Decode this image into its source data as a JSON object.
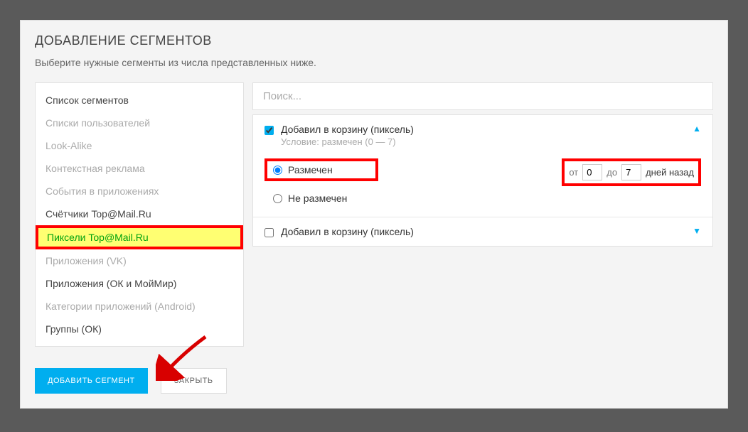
{
  "header": {
    "title": "ДОБАВЛЕНИЕ СЕГМЕНТОВ",
    "subtitle": "Выберите нужные сегменты из числа представленных ниже."
  },
  "segments": {
    "items": [
      {
        "label": "Список сегментов",
        "disabled": false
      },
      {
        "label": "Списки пользователей",
        "disabled": true
      },
      {
        "label": "Look-Alike",
        "disabled": true
      },
      {
        "label": "Контекстная реклама",
        "disabled": true
      },
      {
        "label": "События в приложениях",
        "disabled": true
      },
      {
        "label": "Счётчики Top@Mail.Ru",
        "disabled": false
      },
      {
        "label": "Пиксели Top@Mail.Ru",
        "disabled": false,
        "highlighted": true
      },
      {
        "label": "Приложения (VK)",
        "disabled": true
      },
      {
        "label": "Приложения (ОК и МойМир)",
        "disabled": false
      },
      {
        "label": "Категории приложений (Android)",
        "disabled": true
      },
      {
        "label": "Группы (ОК)",
        "disabled": false
      }
    ]
  },
  "search": {
    "placeholder": "Поиск..."
  },
  "accordion": {
    "item1": {
      "title": "Добавил в корзину (пиксель)",
      "subtitle": "Условие: размечен (0 — 7)",
      "radio_marked": "Размечен",
      "radio_unmarked": "Не размечен",
      "range_from_label": "от",
      "range_from_value": "0",
      "range_to_label": "до",
      "range_to_value": "7",
      "range_suffix": "дней назад"
    },
    "item2": {
      "title": "Добавил в корзину (пиксель)"
    }
  },
  "footer": {
    "primary": "ДОБАВИТЬ СЕГМЕНТ",
    "secondary": "ЗАКРЫТЬ"
  }
}
